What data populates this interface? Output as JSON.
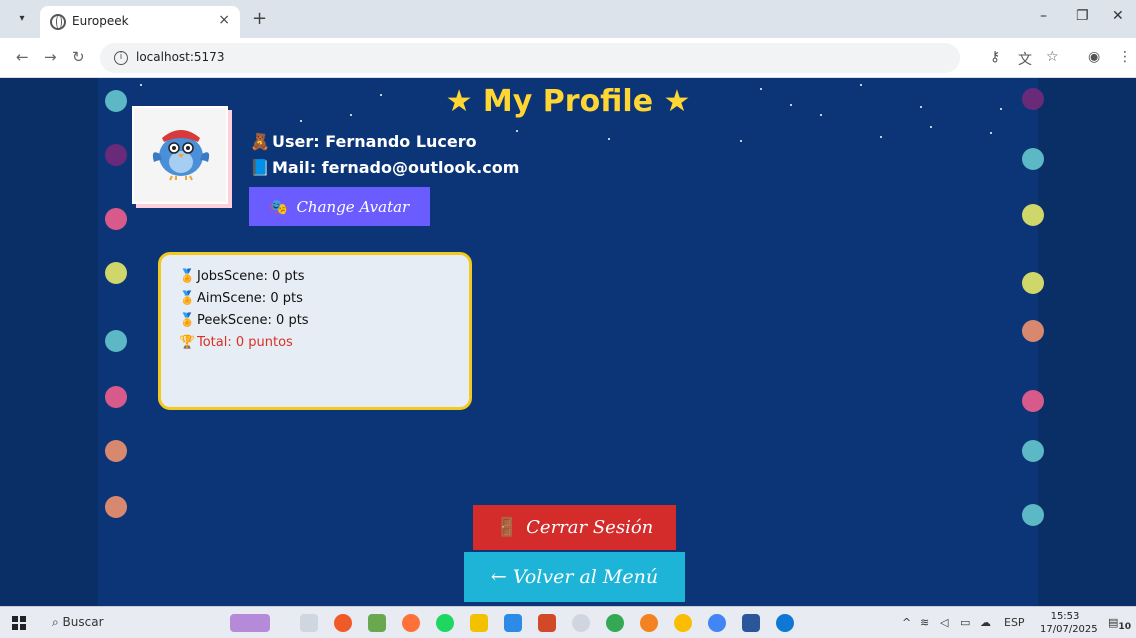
{
  "browser": {
    "tab_title": "Europeek",
    "new_tab": "+",
    "url": "localhost:5173",
    "minimize": "–",
    "restore": "❐",
    "close": "✕"
  },
  "page": {
    "heading": "★ My Profile ★",
    "user_label": "User: Fernando Lucero",
    "mail_label": "Mail: fernado@outlook.com",
    "change_avatar": "Change Avatar",
    "scores": [
      {
        "label": "JobsScene: 0 pts"
      },
      {
        "label": "AimScene: 0 pts"
      },
      {
        "label": "PeekScene: 0 pts"
      }
    ],
    "total": "Total: 0 puntos",
    "logout": "Cerrar Sesión",
    "back_menu": "← Volver al Menú",
    "colors": {
      "background": "#0c3577",
      "accent_yellow": "#ffd633",
      "logout": "#d42b2b",
      "back": "#1db4d8",
      "avatar_button": "#6a5cff",
      "total_red": "#d93025"
    }
  },
  "taskbar": {
    "search_label": "Buscar",
    "language": "ESP",
    "time": "15:53",
    "date": "17/07/2025",
    "notifications": "10"
  }
}
